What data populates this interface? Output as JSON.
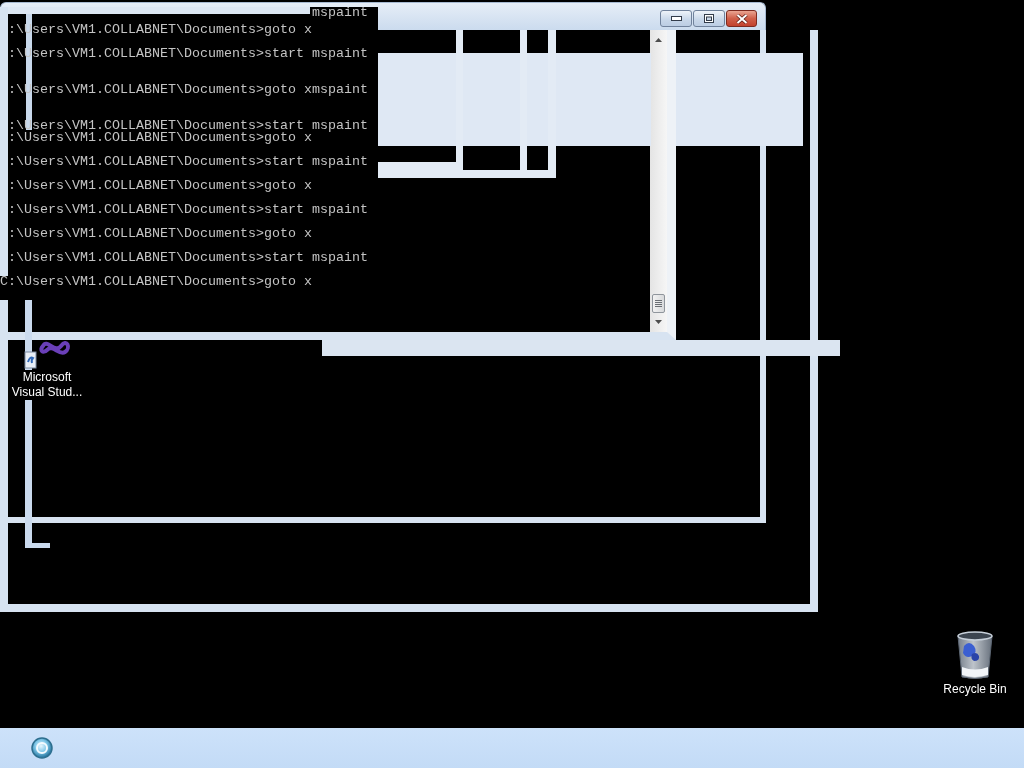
{
  "console_window": {
    "partial_line": "mspaint",
    "lines": [
      ":\\Users\\VM1.COLLABNET\\Documents>goto x",
      ":\\Users\\VM1.COLLABNET\\Documents>start mspaint",
      ":\\Users\\VM1.COLLABNET\\Documents>goto xmspaint",
      ":\\Users\\VM1.COLLABNET\\Documents>start mspaint",
      ":\\Users\\VM1.COLLABNET\\Documents>goto x",
      ":\\Users\\VM1.COLLABNET\\Documents>start mspaint",
      ":\\Users\\VM1.COLLABNET\\Documents>goto x",
      ":\\Users\\VM1.COLLABNET\\Documents>start mspaint",
      ":\\Users\\VM1.COLLABNET\\Documents>goto x",
      ":\\Users\\VM1.COLLABNET\\Documents>start mspaint",
      "C:\\Users\\VM1.COLLABNET\\Documents>goto x"
    ]
  },
  "desktop_icons": [
    {
      "kind": "application",
      "label": "Microsoft Visual Stud..."
    },
    {
      "kind": "bin",
      "label": "Recycle Bin"
    }
  ]
}
